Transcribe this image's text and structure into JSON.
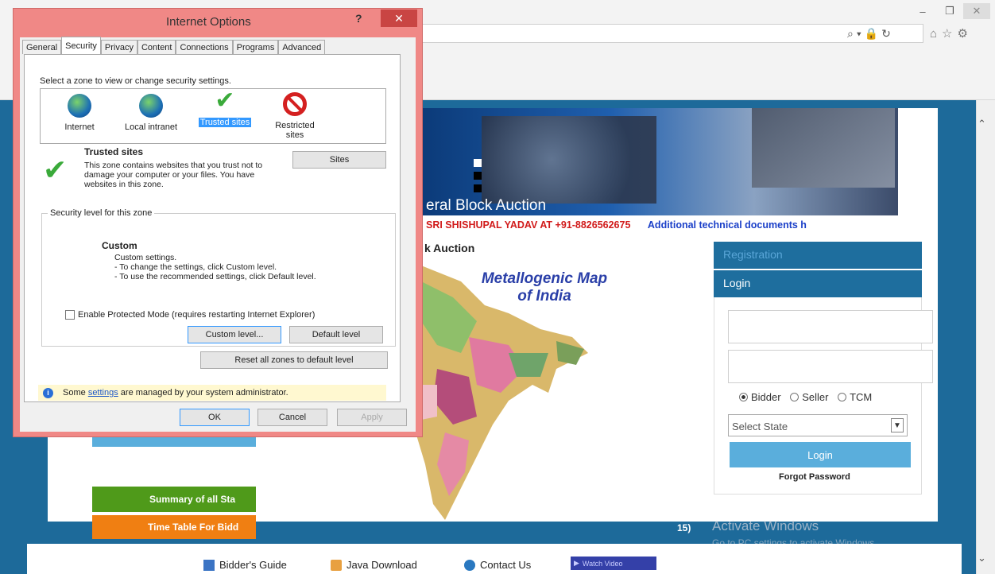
{
  "dialog": {
    "title": "Internet Options",
    "help": "?",
    "close": "✕",
    "tabs": [
      "General",
      "Security",
      "Privacy",
      "Content",
      "Connections",
      "Programs",
      "Advanced"
    ],
    "zone_prompt": "Select a zone to view or change security settings.",
    "zones": [
      {
        "label": "Internet"
      },
      {
        "label": "Local intranet"
      },
      {
        "label": "Trusted sites"
      },
      {
        "label": "Restricted sites"
      }
    ],
    "trusted": {
      "title": "Trusted sites",
      "desc": "This zone contains websites that you trust not to damage your computer or your files. You have websites in this zone.",
      "sites_button": "Sites"
    },
    "security": {
      "legend": "Security level for this zone",
      "title": "Custom",
      "line1": "Custom settings.",
      "line2": "- To change the settings, click Custom level.",
      "line3": "- To use the recommended settings, click Default level.",
      "protected_mode": "Enable Protected Mode (requires restarting Internet Explorer)",
      "custom_level": "Custom level...",
      "default_level": "Default level",
      "reset_all": "Reset all zones to default level"
    },
    "info": {
      "prefix": "Some",
      "link": "settings",
      "suffix": "are managed by your system administrator."
    },
    "ok": "OK",
    "cancel": "Cancel",
    "apply": "Apply"
  },
  "page": {
    "banner_title": "eral Block Auction",
    "marquee_red": "SRI SHISHUPAL YADAV AT +91-8826562675",
    "marquee_blue": "Additional technical documents h",
    "auction_heading": "k Auction",
    "map_title_line1": "Metallogenic Map",
    "map_title_line2": "of India",
    "left_green": "Summary of all Sta",
    "left_orange": "Time Table For Bidd",
    "mid_text": "15)"
  },
  "login": {
    "registration": "Registration",
    "login_header": "Login",
    "radio_options": [
      "Bidder",
      "Seller",
      "TCM"
    ],
    "selected_role": "Bidder",
    "state_placeholder": "Select State",
    "login_button": "Login",
    "forgot": "Forgot Password"
  },
  "footer": {
    "bidders_guide": "Bidder's Guide",
    "java": "Java Download",
    "contact": "Contact Us",
    "watch": "Watch Video"
  },
  "watermark": {
    "title": "Activate Windows",
    "sub": "Go to PC settings to activate Windows."
  },
  "colors": {
    "page_blue": "#1d6a9a",
    "dialog_frame": "#f08886",
    "close_red": "#c94543",
    "green": "#4f9a1a",
    "orange": "#f07f12",
    "light_blue": "#5aaedc"
  }
}
